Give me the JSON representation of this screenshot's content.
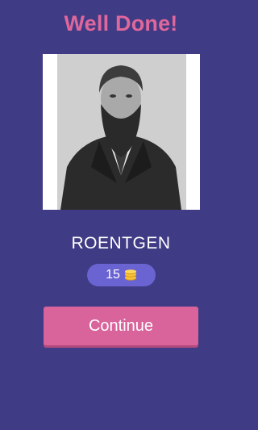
{
  "header": {
    "title": "Well Done!"
  },
  "result": {
    "answer": "ROENTGEN"
  },
  "reward": {
    "value": "15",
    "icon": "coin-stack-icon"
  },
  "actions": {
    "continue_label": "Continue"
  },
  "colors": {
    "background": "#3f3b84",
    "accent": "#e0679c",
    "pill": "#6a64d3",
    "button": "#d9639b"
  }
}
